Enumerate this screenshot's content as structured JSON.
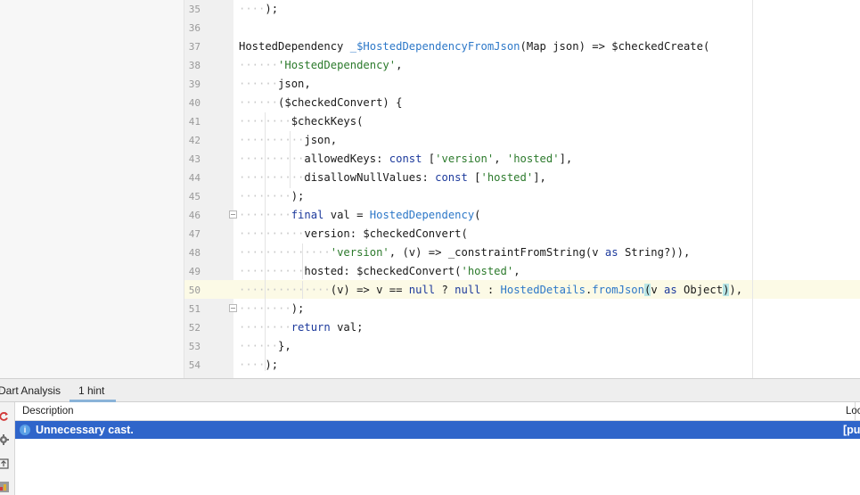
{
  "editor": {
    "lines": [
      {
        "n": "35",
        "tokens": [
          {
            "t": "····",
            "c": "ws"
          },
          {
            "t": ");"
          }
        ]
      },
      {
        "n": "36",
        "tokens": []
      },
      {
        "n": "37",
        "tokens": [
          {
            "t": "HostedDependency "
          },
          {
            "t": "_$HostedDependencyFromJson",
            "c": "cls"
          },
          {
            "t": "(Map json) => $checkedCreate("
          }
        ]
      },
      {
        "n": "38",
        "tokens": [
          {
            "t": "······",
            "c": "ws"
          },
          {
            "t": "'HostedDependency'",
            "c": "str"
          },
          {
            "t": ","
          }
        ]
      },
      {
        "n": "39",
        "tokens": [
          {
            "t": "······",
            "c": "ws"
          },
          {
            "t": "json,"
          }
        ]
      },
      {
        "n": "40",
        "tokens": [
          {
            "t": "······",
            "c": "ws"
          },
          {
            "t": "($checkedConvert) {"
          }
        ]
      },
      {
        "n": "41",
        "tokens": [
          {
            "t": "········",
            "c": "ws"
          },
          {
            "t": "$checkKeys("
          }
        ]
      },
      {
        "n": "42",
        "tokens": [
          {
            "t": "··········",
            "c": "ws"
          },
          {
            "t": "json,"
          }
        ]
      },
      {
        "n": "43",
        "tokens": [
          {
            "t": "··········",
            "c": "ws"
          },
          {
            "t": "allowedKeys: "
          },
          {
            "t": "const",
            "c": "kw"
          },
          {
            "t": " ["
          },
          {
            "t": "'version'",
            "c": "str"
          },
          {
            "t": ", "
          },
          {
            "t": "'hosted'",
            "c": "str"
          },
          {
            "t": "],"
          }
        ]
      },
      {
        "n": "44",
        "tokens": [
          {
            "t": "··········",
            "c": "ws"
          },
          {
            "t": "disallowNullValues: "
          },
          {
            "t": "const",
            "c": "kw"
          },
          {
            "t": " ["
          },
          {
            "t": "'hosted'",
            "c": "str"
          },
          {
            "t": "],"
          }
        ]
      },
      {
        "n": "45",
        "tokens": [
          {
            "t": "········",
            "c": "ws"
          },
          {
            "t": ");"
          }
        ]
      },
      {
        "n": "46",
        "tokens": [
          {
            "t": "········",
            "c": "ws"
          },
          {
            "t": "final",
            "c": "kw"
          },
          {
            "t": " val = "
          },
          {
            "t": "HostedDependency",
            "c": "cls"
          },
          {
            "t": "("
          }
        ]
      },
      {
        "n": "47",
        "tokens": [
          {
            "t": "··········",
            "c": "ws"
          },
          {
            "t": "version: $checkedConvert("
          }
        ]
      },
      {
        "n": "48",
        "tokens": [
          {
            "t": "··············",
            "c": "ws"
          },
          {
            "t": "'version'",
            "c": "str"
          },
          {
            "t": ", (v) => _constraintFromString(v "
          },
          {
            "t": "as",
            "c": "kw"
          },
          {
            "t": " String?)),"
          }
        ]
      },
      {
        "n": "49",
        "tokens": [
          {
            "t": "··········",
            "c": "ws"
          },
          {
            "t": "hosted: $checkedConvert("
          },
          {
            "t": "'hosted'",
            "c": "str"
          },
          {
            "t": ","
          }
        ]
      },
      {
        "n": "50",
        "tokens": [
          {
            "t": "··············",
            "c": "ws"
          },
          {
            "t": "(v) => v == "
          },
          {
            "t": "null",
            "c": "kw"
          },
          {
            "t": " ? "
          },
          {
            "t": "null",
            "c": "kw"
          },
          {
            "t": " : "
          },
          {
            "t": "HostedDetails",
            "c": "cls"
          },
          {
            "t": "."
          },
          {
            "t": "fromJson",
            "c": "cls"
          },
          {
            "t": "(",
            "c": "brace"
          },
          {
            "t": "v "
          },
          {
            "t": "as",
            "c": "kw"
          },
          {
            "t": " Object"
          },
          {
            "t": ")",
            "c": "brace"
          },
          {
            "t": "),"
          }
        ]
      },
      {
        "n": "51",
        "tokens": [
          {
            "t": "········",
            "c": "ws"
          },
          {
            "t": ");"
          }
        ]
      },
      {
        "n": "52",
        "tokens": [
          {
            "t": "········",
            "c": "ws"
          },
          {
            "t": "return",
            "c": "kw"
          },
          {
            "t": " val;"
          }
        ]
      },
      {
        "n": "53",
        "tokens": [
          {
            "t": "······",
            "c": "ws"
          },
          {
            "t": "},"
          }
        ]
      },
      {
        "n": "54",
        "tokens": [
          {
            "t": "····",
            "c": "ws"
          },
          {
            "t": ");"
          }
        ]
      }
    ]
  },
  "panel": {
    "tabs": [
      {
        "label": "Dart Analysis"
      },
      {
        "label": "1 hint"
      }
    ],
    "columns": {
      "description": "Description",
      "location": "Loc"
    },
    "rows": [
      {
        "message": "Unnecessary cast.",
        "location": "[pu"
      }
    ]
  },
  "colors": {
    "selection": "#2f65ca",
    "current_line": "#fcfae6",
    "string": "#2c7a2c",
    "keyword": "#1d3a9c",
    "class": "#2d78c8"
  },
  "icons": [
    "refresh-icon",
    "gear-icon",
    "export-icon",
    "filter-icon",
    "info-icon"
  ]
}
